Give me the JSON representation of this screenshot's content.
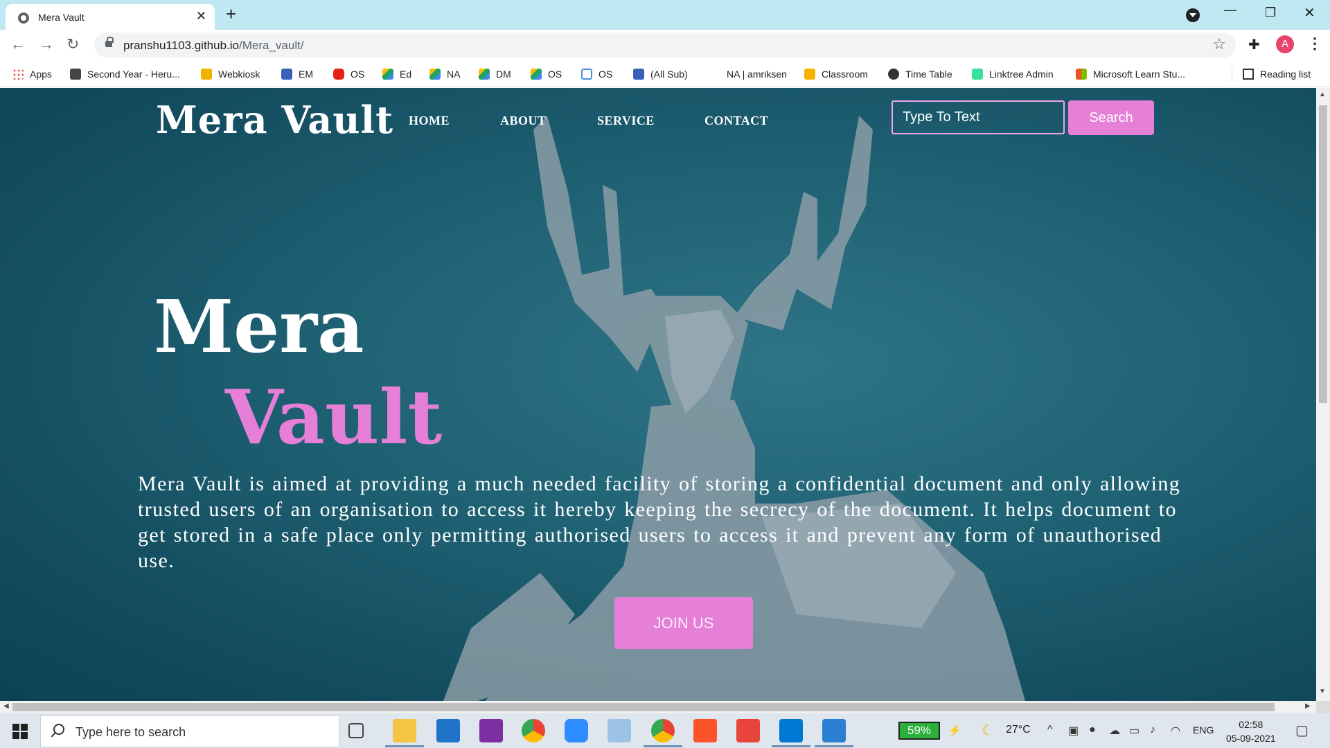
{
  "browser": {
    "tab_title": "Mera Vault",
    "url_host": "pranshu1103.github.io",
    "url_path": "/Mera_vault/",
    "profile_initial": "A",
    "bookmarks": [
      {
        "label": "Apps",
        "icon_color": "#ea4335"
      },
      {
        "label": "Second Year - Heru...",
        "icon_color": "#444444"
      },
      {
        "label": "Webkiosk",
        "icon_color": "#f0b400"
      },
      {
        "label": "EM",
        "icon_color": "#3a5fb8"
      },
      {
        "label": "OS",
        "icon_color": "#e62117"
      },
      {
        "label": "Ed",
        "icon_color": "#1fa463"
      },
      {
        "label": "NA",
        "icon_color": "#1fa463"
      },
      {
        "label": "DM",
        "icon_color": "#1fa463"
      },
      {
        "label": "OS",
        "icon_color": "#1fa463"
      },
      {
        "label": "OS",
        "icon_color": "#4a90e2"
      },
      {
        "label": "(All Sub)",
        "icon_color": "#3a5fb8"
      },
      {
        "label": "NA | amriksen",
        "icon_color": "#ffffff"
      },
      {
        "label": "Classroom",
        "icon_color": "#f4b400"
      },
      {
        "label": "Time Table",
        "icon_color": "#333333"
      },
      {
        "label": "Linktree Admin",
        "icon_color": "#39e09b"
      },
      {
        "label": "Microsoft Learn Stu...",
        "icon_color": "#f25022"
      }
    ],
    "reading_list": "Reading list"
  },
  "site": {
    "logo": "Mera Vault",
    "nav": [
      "HOME",
      "ABOUT",
      "SERVICE",
      "CONTACT"
    ],
    "search_placeholder": "Type To Text",
    "search_button": "Search",
    "hero_title_1": "Mera",
    "hero_title_2": "Vault",
    "description": "Mera Vault is aimed at providing a much needed facility of storing a confidential document and only allowing trusted users of an organisation to access it hereby keeping the secrecy of the document. It helps document to get stored in a safe place only permitting authorised users to access it and prevent any form of unauthorised use.",
    "join_button": "JOIN US",
    "accent_color": "#e57fd8"
  },
  "taskbar": {
    "search_placeholder": "Type here to search",
    "battery": "59%",
    "temperature": "27°C",
    "language": "ENG",
    "time": "02:58",
    "date": "05-09-2021"
  }
}
